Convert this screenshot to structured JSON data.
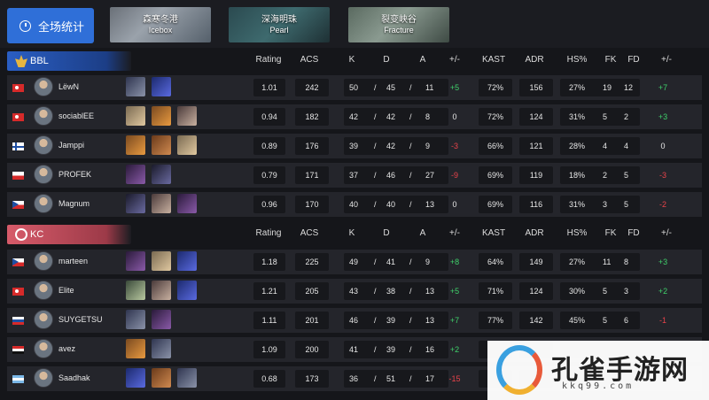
{
  "nav": {
    "overall_label": "全场统计",
    "maps": [
      {
        "zh": "森寒冬港",
        "en": "Icebox"
      },
      {
        "zh": "深海明珠",
        "en": "Pearl"
      },
      {
        "zh": "裂变峡谷",
        "en": "Fracture"
      }
    ]
  },
  "columns": [
    "Rating",
    "ACS",
    "K",
    "D",
    "A",
    "+/-",
    "KAST",
    "ADR",
    "HS%",
    "FK",
    "FD",
    "+/-"
  ],
  "teams": [
    {
      "name": "BBL",
      "color": "#2a5ec4",
      "players": [
        {
          "flag": "tr",
          "name": "LëwN",
          "agents": [
            "a1",
            "a2"
          ],
          "rating": "1.01",
          "acs": "242",
          "k": "50",
          "d": "45",
          "a": "11",
          "kd_diff": "+5",
          "kast": "72%",
          "adr": "156",
          "hs": "27%",
          "fk": "19",
          "fd": "12",
          "fkfd_diff": "+7"
        },
        {
          "flag": "tr",
          "name": "sociablEE",
          "agents": [
            "a3",
            "a4",
            "a5"
          ],
          "rating": "0.94",
          "acs": "182",
          "k": "42",
          "d": "42",
          "a": "8",
          "kd_diff": "0",
          "kast": "72%",
          "adr": "124",
          "hs": "31%",
          "fk": "5",
          "fd": "2",
          "fkfd_diff": "+3"
        },
        {
          "flag": "fi",
          "name": "Jamppi",
          "agents": [
            "a4",
            "a6",
            "a3"
          ],
          "rating": "0.89",
          "acs": "176",
          "k": "39",
          "d": "42",
          "a": "9",
          "kd_diff": "-3",
          "kast": "66%",
          "adr": "121",
          "hs": "28%",
          "fk": "4",
          "fd": "4",
          "fkfd_diff": "0"
        },
        {
          "flag": "pl",
          "name": "PROFEK",
          "agents": [
            "a7",
            "a8"
          ],
          "rating": "0.79",
          "acs": "171",
          "k": "37",
          "d": "46",
          "a": "27",
          "kd_diff": "-9",
          "kast": "69%",
          "adr": "119",
          "hs": "18%",
          "fk": "2",
          "fd": "5",
          "fkfd_diff": "-3"
        },
        {
          "flag": "cz",
          "name": "Magnum",
          "agents": [
            "a8",
            "a5",
            "a7"
          ],
          "rating": "0.96",
          "acs": "170",
          "k": "40",
          "d": "40",
          "a": "13",
          "kd_diff": "0",
          "kast": "69%",
          "adr": "116",
          "hs": "31%",
          "fk": "3",
          "fd": "5",
          "fkfd_diff": "-2"
        }
      ]
    },
    {
      "name": "KC",
      "color": "#d75b6a",
      "players": [
        {
          "flag": "cz",
          "name": "marteen",
          "agents": [
            "a7",
            "a3",
            "a2"
          ],
          "rating": "1.18",
          "acs": "225",
          "k": "49",
          "d": "41",
          "a": "9",
          "kd_diff": "+8",
          "kast": "64%",
          "adr": "149",
          "hs": "27%",
          "fk": "11",
          "fd": "8",
          "fkfd_diff": "+3"
        },
        {
          "flag": "tr",
          "name": "Elite",
          "agents": [
            "a9",
            "a5",
            "a2"
          ],
          "rating": "1.21",
          "acs": "205",
          "k": "43",
          "d": "38",
          "a": "13",
          "kd_diff": "+5",
          "kast": "71%",
          "adr": "124",
          "hs": "30%",
          "fk": "5",
          "fd": "3",
          "fkfd_diff": "+2"
        },
        {
          "flag": "ru",
          "name": "SUYGETSU",
          "agents": [
            "a1",
            "a7"
          ],
          "rating": "1.11",
          "acs": "201",
          "k": "46",
          "d": "39",
          "a": "13",
          "kd_diff": "+7",
          "kast": "77%",
          "adr": "142",
          "hs": "45%",
          "fk": "5",
          "fd": "6",
          "fkfd_diff": "-1"
        },
        {
          "flag": "eg",
          "name": "avez",
          "agents": [
            "a4",
            "a1"
          ],
          "rating": "1.09",
          "acs": "200",
          "k": "41",
          "d": "39",
          "a": "16",
          "kd_diff": "+2",
          "kast": "",
          "adr": "",
          "hs": "",
          "fk": "",
          "fd": "",
          "fkfd_diff": ""
        },
        {
          "flag": "ar",
          "name": "Saadhak",
          "agents": [
            "a2",
            "a6",
            "a1"
          ],
          "rating": "0.68",
          "acs": "173",
          "k": "36",
          "d": "51",
          "a": "17",
          "kd_diff": "-15",
          "kast": "",
          "adr": "",
          "hs": "",
          "fk": "",
          "fd": "",
          "fkfd_diff": ""
        }
      ]
    }
  ],
  "watermark": {
    "title": "孔雀手游网",
    "sub": "kkq99.com"
  }
}
